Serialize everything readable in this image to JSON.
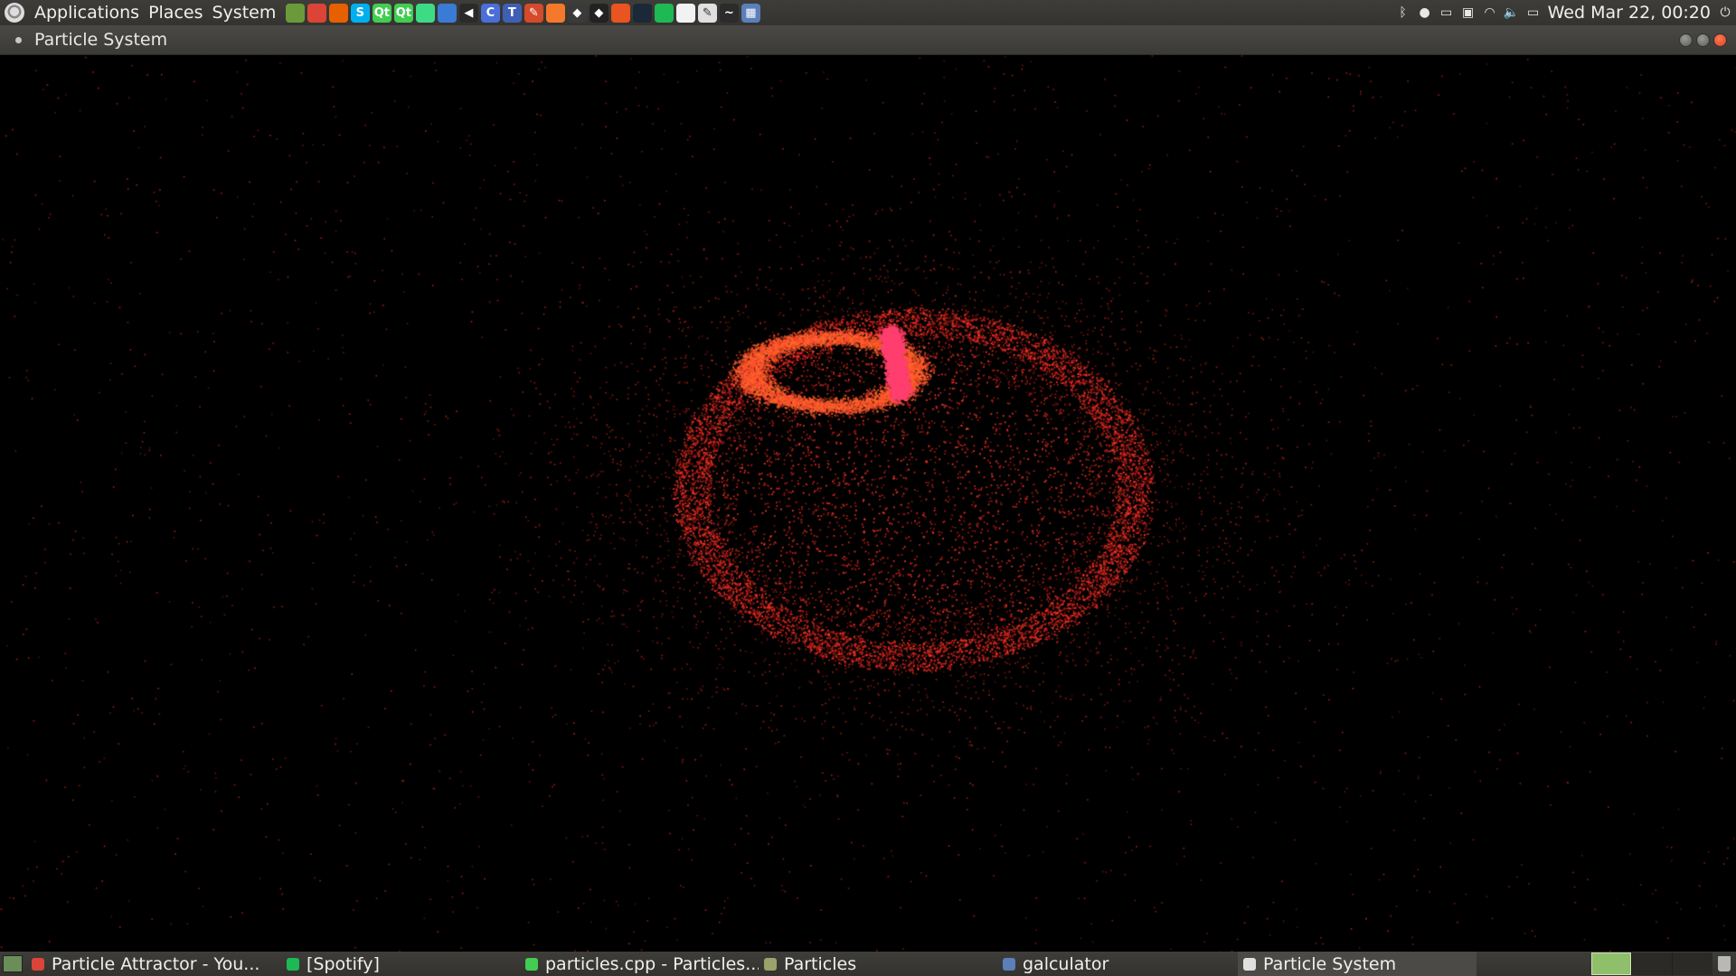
{
  "top_panel": {
    "menus": [
      "Applications",
      "Places",
      "System"
    ],
    "launchers": [
      {
        "name": "home-folder-icon",
        "color": "#6a9a3a",
        "glyph": ""
      },
      {
        "name": "chrome-icon",
        "color": "#db4437",
        "glyph": ""
      },
      {
        "name": "firefox-icon",
        "color": "#e66000",
        "glyph": ""
      },
      {
        "name": "skype-icon",
        "color": "#00aff0",
        "glyph": "S"
      },
      {
        "name": "qt-creator-icon",
        "color": "#41cd52",
        "glyph": "Qt"
      },
      {
        "name": "qt-designer-icon",
        "color": "#41cd52",
        "glyph": "Qt"
      },
      {
        "name": "android-studio-icon",
        "color": "#3ddc84",
        "glyph": ""
      },
      {
        "name": "thunderbird-icon",
        "color": "#3a7bd5",
        "glyph": ""
      },
      {
        "name": "sound-icon",
        "color": "#2a2a2a",
        "glyph": "◀"
      },
      {
        "name": "app-blue-icon",
        "color": "#4a6fd8",
        "glyph": "C"
      },
      {
        "name": "grid-app-icon",
        "color": "#3f5fb5",
        "glyph": "T"
      },
      {
        "name": "editor-icon",
        "color": "#d44a2a",
        "glyph": "✎"
      },
      {
        "name": "blender-icon",
        "color": "#f5792a",
        "glyph": ""
      },
      {
        "name": "gamepad-icon",
        "color": "#3a3a3a",
        "glyph": "◆"
      },
      {
        "name": "inkscape-icon",
        "color": "#222222",
        "glyph": "◆"
      },
      {
        "name": "ubuntu-icon",
        "color": "#e95420",
        "glyph": ""
      },
      {
        "name": "steam-icon",
        "color": "#1b2838",
        "glyph": ""
      },
      {
        "name": "spotify-icon",
        "color": "#1db954",
        "glyph": ""
      },
      {
        "name": "text-file-icon",
        "color": "#f2f2f2",
        "glyph": ""
      },
      {
        "name": "text-editor-icon",
        "color": "#e0e0e0",
        "glyph": "✎"
      },
      {
        "name": "system-monitor-icon",
        "color": "#2b2b2b",
        "glyph": "~"
      },
      {
        "name": "calculator-icon",
        "color": "#5b7fb8",
        "glyph": "▦"
      }
    ],
    "tray": [
      {
        "name": "bluetooth-icon",
        "glyph": "ᛒ"
      },
      {
        "name": "messaging-icon",
        "glyph": "●"
      },
      {
        "name": "display-icon",
        "glyph": "▭"
      },
      {
        "name": "monitor-icon",
        "glyph": "▣"
      },
      {
        "name": "wifi-icon",
        "glyph": "◠"
      },
      {
        "name": "volume-icon",
        "glyph": "🔈"
      },
      {
        "name": "battery-icon",
        "glyph": "▭"
      }
    ],
    "clock": "Wed Mar 22, 00:20",
    "power_glyph": "⏻"
  },
  "window": {
    "title": "Particle System"
  },
  "scene": {
    "background": "#000000",
    "particle_color": "#ff2a2a",
    "core_color": "#ff4070",
    "description_glyph": ""
  },
  "taskbar": {
    "tasks": [
      {
        "label": "Particle Attractor - You...",
        "icon_color": "#db4437",
        "active": false
      },
      {
        "label": "[Spotify]",
        "icon_color": "#1db954",
        "active": false
      },
      {
        "label": "particles.cpp - Particles...",
        "icon_color": "#41cd52",
        "active": false
      },
      {
        "label": "Particles",
        "icon_color": "#9aa36a",
        "active": false
      },
      {
        "label": "galculator",
        "icon_color": "#5b7fb8",
        "active": false
      },
      {
        "label": "Particle System",
        "icon_color": "#e0e0e0",
        "active": true
      }
    ],
    "workspaces": [
      true,
      false,
      false
    ]
  }
}
